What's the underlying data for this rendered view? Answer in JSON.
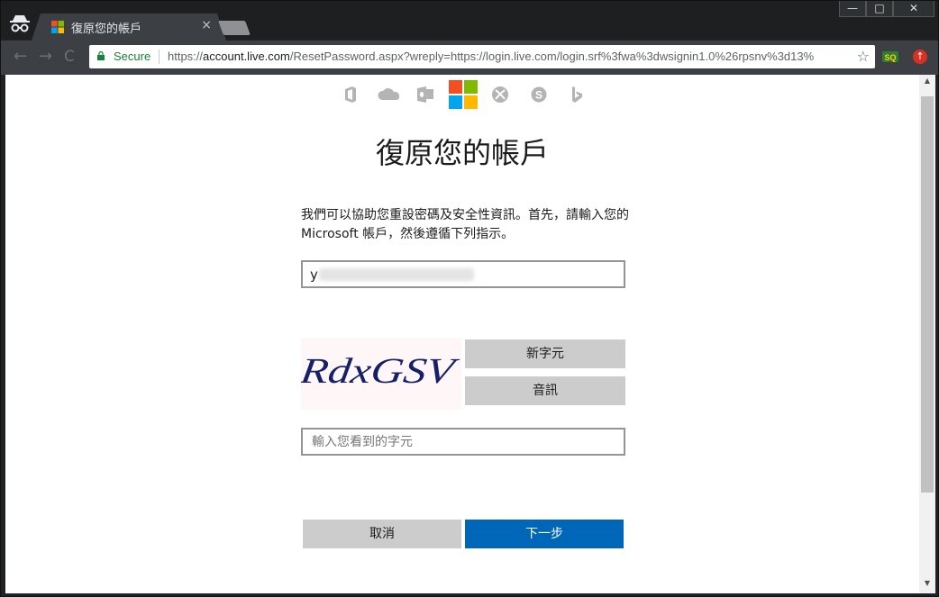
{
  "browser": {
    "tab_title": "復原您的帳戶",
    "tab_close": "×",
    "window_controls": {
      "minimize": "—",
      "maximize": "□",
      "close": "✕"
    },
    "nav": {
      "back": "←",
      "forward": "→",
      "reload": "C"
    },
    "address": {
      "secure_label": "Secure",
      "url_scheme": "https://",
      "url_host": "account.live.com",
      "url_path": "/ResetPassword.aspx?wreply=https://login.live.com/login.srf%3fwa%3dwsignin1.0%26rpsnv%3d13%",
      "star": "☆"
    },
    "extensions": {
      "sq_label": "SQ",
      "update_arrow": "↑"
    }
  },
  "page": {
    "title": "復原您的帳戶",
    "description": "我們可以協助您重設密碼及安全性資訊。首先，請輸入您的 Microsoft 帳戶，然後遵循下列指示。",
    "account_value": "y",
    "captcha_text": "RdxGSV",
    "new_chars_button": "新字元",
    "audio_button": "音訊",
    "captcha_input_placeholder": "輸入您看到的字元",
    "cancel_button": "取消",
    "next_button": "下一步"
  },
  "colors": {
    "primary_button": "#0067b8",
    "secondary_button": "#cccccc",
    "ms_red": "#f25022",
    "ms_green": "#7fba00",
    "ms_blue": "#00a4ef",
    "ms_yellow": "#ffb900"
  },
  "icons": [
    "incognito-icon",
    "microsoft-logo-icon",
    "lock-icon",
    "star-icon",
    "office-icon",
    "onedrive-icon",
    "outlook-icon",
    "xbox-icon",
    "skype-icon",
    "bing-icon"
  ]
}
